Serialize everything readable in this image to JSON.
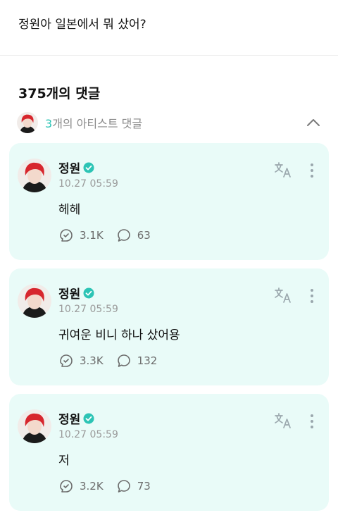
{
  "post": {
    "text": "정원아 일본에서 뭐 샀어?"
  },
  "comments_header": {
    "label": "375개의 댓글"
  },
  "artist_comments": {
    "count": "3",
    "label": "개의 아티스트 댓글"
  },
  "comments": [
    {
      "name": "정원",
      "time": "10.27 05:59",
      "text": "헤헤",
      "likes": "3.1K",
      "replies": "63"
    },
    {
      "name": "정원",
      "time": "10.27 05:59",
      "text": "귀여운 비니 하나 샀어용",
      "likes": "3.3K",
      "replies": "132"
    },
    {
      "name": "정원",
      "time": "10.27 05:59",
      "text": "저",
      "likes": "3.2K",
      "replies": "73"
    }
  ],
  "colors": {
    "accent": "#2cc4b5",
    "card_bg": "#e9fbf8",
    "hair": "#d7262d"
  },
  "icons": [
    "chevron-up-icon",
    "verified-icon",
    "translate-icon",
    "more-vertical-icon",
    "like-icon",
    "reply-icon"
  ]
}
